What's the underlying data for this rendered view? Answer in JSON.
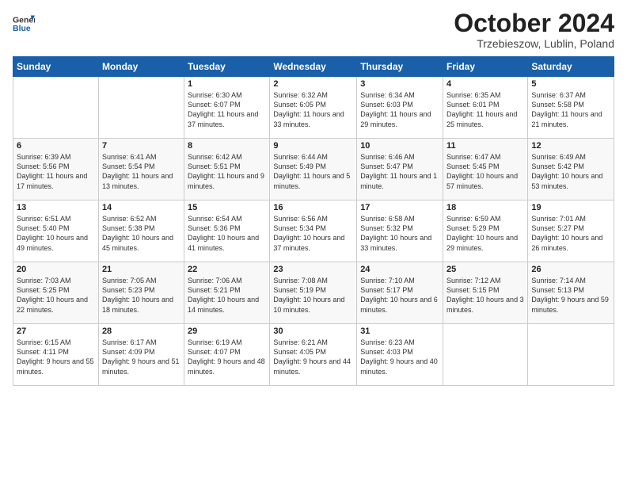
{
  "logo": {
    "general": "General",
    "blue": "Blue"
  },
  "title": "October 2024",
  "location": "Trzebieszow, Lublin, Poland",
  "weekdays": [
    "Sunday",
    "Monday",
    "Tuesday",
    "Wednesday",
    "Thursday",
    "Friday",
    "Saturday"
  ],
  "weeks": [
    [
      {
        "day": "",
        "info": ""
      },
      {
        "day": "",
        "info": ""
      },
      {
        "day": "1",
        "info": "Sunrise: 6:30 AM\nSunset: 6:07 PM\nDaylight: 11 hours and 37 minutes."
      },
      {
        "day": "2",
        "info": "Sunrise: 6:32 AM\nSunset: 6:05 PM\nDaylight: 11 hours and 33 minutes."
      },
      {
        "day": "3",
        "info": "Sunrise: 6:34 AM\nSunset: 6:03 PM\nDaylight: 11 hours and 29 minutes."
      },
      {
        "day": "4",
        "info": "Sunrise: 6:35 AM\nSunset: 6:01 PM\nDaylight: 11 hours and 25 minutes."
      },
      {
        "day": "5",
        "info": "Sunrise: 6:37 AM\nSunset: 5:58 PM\nDaylight: 11 hours and 21 minutes."
      }
    ],
    [
      {
        "day": "6",
        "info": "Sunrise: 6:39 AM\nSunset: 5:56 PM\nDaylight: 11 hours and 17 minutes."
      },
      {
        "day": "7",
        "info": "Sunrise: 6:41 AM\nSunset: 5:54 PM\nDaylight: 11 hours and 13 minutes."
      },
      {
        "day": "8",
        "info": "Sunrise: 6:42 AM\nSunset: 5:51 PM\nDaylight: 11 hours and 9 minutes."
      },
      {
        "day": "9",
        "info": "Sunrise: 6:44 AM\nSunset: 5:49 PM\nDaylight: 11 hours and 5 minutes."
      },
      {
        "day": "10",
        "info": "Sunrise: 6:46 AM\nSunset: 5:47 PM\nDaylight: 11 hours and 1 minute."
      },
      {
        "day": "11",
        "info": "Sunrise: 6:47 AM\nSunset: 5:45 PM\nDaylight: 10 hours and 57 minutes."
      },
      {
        "day": "12",
        "info": "Sunrise: 6:49 AM\nSunset: 5:42 PM\nDaylight: 10 hours and 53 minutes."
      }
    ],
    [
      {
        "day": "13",
        "info": "Sunrise: 6:51 AM\nSunset: 5:40 PM\nDaylight: 10 hours and 49 minutes."
      },
      {
        "day": "14",
        "info": "Sunrise: 6:52 AM\nSunset: 5:38 PM\nDaylight: 10 hours and 45 minutes."
      },
      {
        "day": "15",
        "info": "Sunrise: 6:54 AM\nSunset: 5:36 PM\nDaylight: 10 hours and 41 minutes."
      },
      {
        "day": "16",
        "info": "Sunrise: 6:56 AM\nSunset: 5:34 PM\nDaylight: 10 hours and 37 minutes."
      },
      {
        "day": "17",
        "info": "Sunrise: 6:58 AM\nSunset: 5:32 PM\nDaylight: 10 hours and 33 minutes."
      },
      {
        "day": "18",
        "info": "Sunrise: 6:59 AM\nSunset: 5:29 PM\nDaylight: 10 hours and 29 minutes."
      },
      {
        "day": "19",
        "info": "Sunrise: 7:01 AM\nSunset: 5:27 PM\nDaylight: 10 hours and 26 minutes."
      }
    ],
    [
      {
        "day": "20",
        "info": "Sunrise: 7:03 AM\nSunset: 5:25 PM\nDaylight: 10 hours and 22 minutes."
      },
      {
        "day": "21",
        "info": "Sunrise: 7:05 AM\nSunset: 5:23 PM\nDaylight: 10 hours and 18 minutes."
      },
      {
        "day": "22",
        "info": "Sunrise: 7:06 AM\nSunset: 5:21 PM\nDaylight: 10 hours and 14 minutes."
      },
      {
        "day": "23",
        "info": "Sunrise: 7:08 AM\nSunset: 5:19 PM\nDaylight: 10 hours and 10 minutes."
      },
      {
        "day": "24",
        "info": "Sunrise: 7:10 AM\nSunset: 5:17 PM\nDaylight: 10 hours and 6 minutes."
      },
      {
        "day": "25",
        "info": "Sunrise: 7:12 AM\nSunset: 5:15 PM\nDaylight: 10 hours and 3 minutes."
      },
      {
        "day": "26",
        "info": "Sunrise: 7:14 AM\nSunset: 5:13 PM\nDaylight: 9 hours and 59 minutes."
      }
    ],
    [
      {
        "day": "27",
        "info": "Sunrise: 6:15 AM\nSunset: 4:11 PM\nDaylight: 9 hours and 55 minutes."
      },
      {
        "day": "28",
        "info": "Sunrise: 6:17 AM\nSunset: 4:09 PM\nDaylight: 9 hours and 51 minutes."
      },
      {
        "day": "29",
        "info": "Sunrise: 6:19 AM\nSunset: 4:07 PM\nDaylight: 9 hours and 48 minutes."
      },
      {
        "day": "30",
        "info": "Sunrise: 6:21 AM\nSunset: 4:05 PM\nDaylight: 9 hours and 44 minutes."
      },
      {
        "day": "31",
        "info": "Sunrise: 6:23 AM\nSunset: 4:03 PM\nDaylight: 9 hours and 40 minutes."
      },
      {
        "day": "",
        "info": ""
      },
      {
        "day": "",
        "info": ""
      }
    ]
  ]
}
